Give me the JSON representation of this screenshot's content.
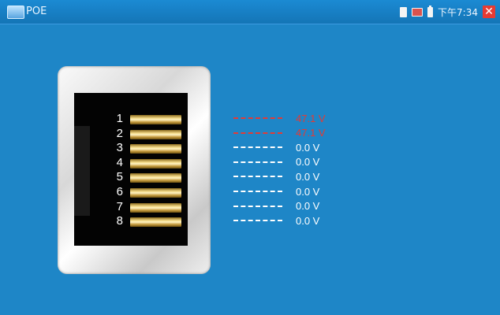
{
  "window": {
    "title": "POE",
    "clock": "下午7:34"
  },
  "status_icons": [
    "sd-card-icon",
    "network-icon",
    "battery-icon",
    "close-icon"
  ],
  "close_glyph": "✕",
  "colors": {
    "active": "#e23b36",
    "inactive": "#ffffff",
    "background": "#1e86c7"
  },
  "pins": [
    {
      "number": "1",
      "voltage": "47.1 V",
      "active": true
    },
    {
      "number": "2",
      "voltage": "47.1 V",
      "active": true
    },
    {
      "number": "3",
      "voltage": "0.0 V",
      "active": false
    },
    {
      "number": "4",
      "voltage": "0.0 V",
      "active": false
    },
    {
      "number": "5",
      "voltage": "0.0 V",
      "active": false
    },
    {
      "number": "6",
      "voltage": "0.0 V",
      "active": false
    },
    {
      "number": "7",
      "voltage": "0.0 V",
      "active": false
    },
    {
      "number": "8",
      "voltage": "0.0 V",
      "active": false
    }
  ]
}
